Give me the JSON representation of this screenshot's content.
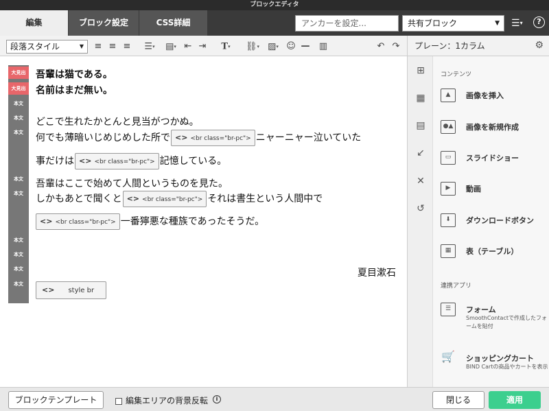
{
  "window": {
    "title": "ブロックエディタ"
  },
  "tabs": [
    {
      "label": "編集",
      "active": true
    },
    {
      "label": "ブロック設定",
      "active": false
    },
    {
      "label": "CSS詳細",
      "active": false
    }
  ],
  "anchor": {
    "placeholder": "アンカーを設定..."
  },
  "shared_block": {
    "selected": "共有ブロック"
  },
  "toolbar": {
    "paragraph_style": "段落スタイル"
  },
  "right_panel": {
    "title": "プレーン：1カラム",
    "section_contents": "コンテンツ",
    "items": [
      {
        "label": "画像を挿入"
      },
      {
        "label": "画像を新規作成"
      },
      {
        "label": "スライドショー"
      },
      {
        "label": "動画"
      },
      {
        "label": "ダウンロードボタン"
      },
      {
        "label": "表（テーブル）"
      }
    ],
    "section_apps": "連携アプリ",
    "apps": [
      {
        "label": "フォーム",
        "desc": "SmoothContactで作成したフォームを貼付"
      },
      {
        "label": "ショッピングカート",
        "desc": "BIND Cartの商品やカートを表示"
      }
    ]
  },
  "editor": {
    "tags": {
      "heading": "大見出",
      "body": "本文"
    },
    "lines": {
      "h1": "吾輩は猫である。",
      "h2": "名前はまだ無い。",
      "l1": "どこで生れたかとんと見当がつかぬ。",
      "l2a": "何でも薄暗いじめじめした所で",
      "l2b": "ニャーニャー泣いていた",
      "l3a": "事だけは",
      "l3b": "記憶している。",
      "l4": "吾輩はここで始めて人間というものを見た。",
      "l5a": "しかもあとで聞くと",
      "l5b": "それは書生という人間中で",
      "l6b": "一番獰悪な種族であったそうだ。"
    },
    "br_chip": "<br class=\"br-pc\">",
    "br_icon": "<>",
    "signature": "夏目漱石",
    "style_chip": "style br"
  },
  "bottom": {
    "template_button": "ブロックテンプレート",
    "bg_toggle": "編集エリアの背景反転",
    "close_button": "閉じる",
    "apply_button": "適用"
  },
  "colors": {
    "heading_tag": "#e8666a",
    "apply": "#3ccf8e",
    "topbar": "#3a3a3a"
  }
}
